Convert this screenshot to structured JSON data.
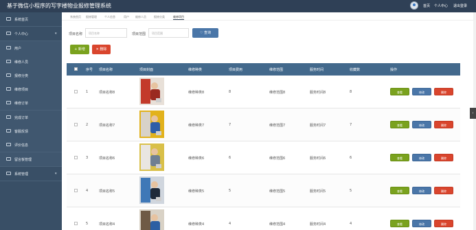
{
  "app": {
    "title": "基于微信小程序的写字楼物业报修管理系统",
    "nav": [
      "首页",
      "个人中心",
      "退出登录"
    ]
  },
  "sidebar": {
    "items": [
      {
        "label": "系统首页",
        "icon": "home-icon"
      },
      {
        "label": "个人中心",
        "icon": "user-icon",
        "chevron": true
      },
      {
        "label": "用户",
        "icon": "list-icon",
        "sub": true
      },
      {
        "label": "维修人员",
        "icon": "list-icon",
        "sub": true
      },
      {
        "label": "报修分类",
        "icon": "list-icon",
        "sub": true
      },
      {
        "label": "维修项目",
        "icon": "list-icon",
        "sub": true,
        "active": true
      },
      {
        "label": "维修订单",
        "icon": "list-icon",
        "sub": true
      },
      {
        "label": "完成订单",
        "icon": "list-icon",
        "sub": true
      },
      {
        "label": "客服反馈",
        "icon": "list-icon",
        "sub": true
      },
      {
        "label": "评价信息",
        "icon": "list-icon",
        "sub": true
      },
      {
        "label": "留言板管理",
        "icon": "list-icon",
        "sub": true
      },
      {
        "label": "系统管理",
        "icon": "settings-icon",
        "chevron": true
      }
    ]
  },
  "tabs": [
    "系统首页",
    "报修管理",
    "个人信息",
    "用户",
    "维修人员",
    "报修分类",
    "维修项目"
  ],
  "search": {
    "name_label": "项目名称",
    "name_placeholder": "项目名称",
    "range_label": "项目范围",
    "range_placeholder": "项目范围",
    "search_button": "查询"
  },
  "toolbar": {
    "add": "新增",
    "delete": "删除"
  },
  "table": {
    "headers": [
      "序号",
      "项目名称",
      "项目封面",
      "维修种类",
      "项目费用",
      "维修范围",
      "服务时间",
      "收藏数",
      "操作"
    ],
    "rows": [
      {
        "index": "1",
        "name": "项目名称8",
        "kind": "维修种类8",
        "fee": "8",
        "range": "维修范围8",
        "time": "服务时间8",
        "fav": "8"
      },
      {
        "index": "2",
        "name": "项目名称7",
        "kind": "维修种类7",
        "fee": "7",
        "range": "维修范围7",
        "time": "服务时间7",
        "fav": "7"
      },
      {
        "index": "3",
        "name": "项目名称6",
        "kind": "维修种类6",
        "fee": "6",
        "range": "维修范围6",
        "time": "服务时间6",
        "fav": "6"
      },
      {
        "index": "4",
        "name": "项目名称5",
        "kind": "维修种类5",
        "fee": "5",
        "range": "维修范围5",
        "time": "服务时间5",
        "fav": "5"
      },
      {
        "index": "5",
        "name": "项目名称4",
        "kind": "维修种类4",
        "fee": "4",
        "range": "维修范围4",
        "time": "服务时间4",
        "fav": "4"
      }
    ],
    "actions": {
      "detail": "查看",
      "edit": "修改",
      "delete": "删除"
    }
  },
  "colors": {
    "header": "#2f4056",
    "sidebar": "#394f66",
    "thead": "#43698c",
    "add": "#7aa21e",
    "delete": "#d9452d",
    "edit": "#4a76a8"
  }
}
